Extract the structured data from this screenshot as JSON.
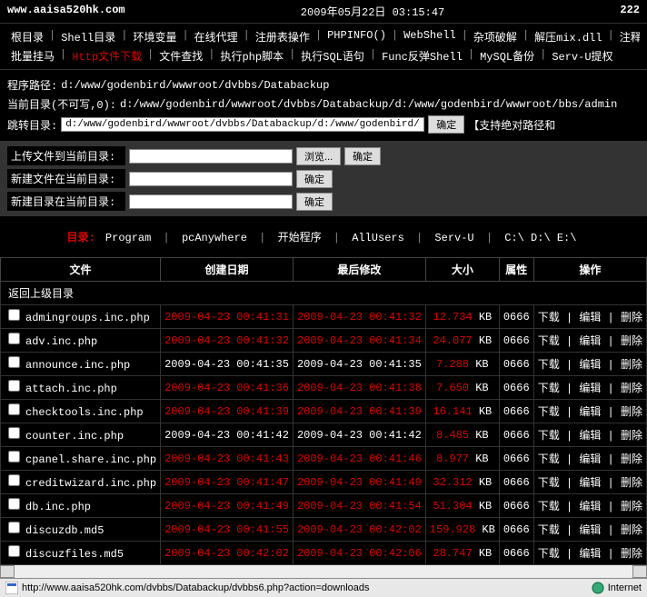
{
  "header": {
    "url": "www.aaisa520hk.com",
    "datetime": "2009年05月22日 03:15:47",
    "count": "222"
  },
  "menu": {
    "row1": [
      "根目录",
      "Shell目录",
      "环境变量",
      "在线代理",
      "注册表操作",
      "PHPINFO()",
      "WebShell",
      "杂项破解",
      "解压mix.dll",
      "注释"
    ],
    "row2": [
      "批量挂马",
      "Http文件下载",
      "文件查找",
      "执行php脚本",
      "执行SQL语句",
      "Func反弹Shell",
      "MySQL备份",
      "Serv-U提权"
    ],
    "active": "Http文件下载"
  },
  "paths": {
    "prog_label": "程序路径:",
    "prog_val": "d:/www/godenbird/wwwroot/dvbbs/Databackup",
    "cur_label": "当前目录(不可写,0):",
    "cur_val": "d:/www/godenbird/wwwroot/dvbbs/Databackup/d:/www/godenbird/wwwroot/bbs/admin",
    "jump_label": "跳转目录:",
    "jump_val": "d:/www/godenbird/wwwroot/dvbbs/Databackup/d:/www/godenbird/wwwroot/bbs/admin",
    "confirm": "确定",
    "support": "【支持绝对路径和"
  },
  "forms": {
    "upload_label": "上传文件到当前目录:",
    "browse": "浏览...",
    "newfile_label": "新建文件在当前目录:",
    "newdir_label": "新建目录在当前目录:",
    "confirm": "确定"
  },
  "quicklinks": {
    "label": "目录:",
    "items": [
      "Program",
      "pcAnywhere",
      "开始程序",
      "AllUsers",
      "Serv-U",
      "C:\\ D:\\ E:\\"
    ]
  },
  "table": {
    "headers": [
      "文件",
      "创建日期",
      "最后修改",
      "大小",
      "属性",
      "操作"
    ],
    "back": "返回上级目录",
    "actions": {
      "dl": "下载",
      "ed": "编辑",
      "del": "删除"
    },
    "rows": [
      {
        "name": "admingroups.inc.php",
        "created": "2009-04-23 00:41:31",
        "modified": "2009-04-23 00:41:32",
        "size": "12.734",
        "attr": "0666",
        "cred": true,
        "mred": true
      },
      {
        "name": "adv.inc.php",
        "created": "2009-04-23 00:41:32",
        "modified": "2009-04-23 00:41:34",
        "size": "24.077",
        "attr": "0666",
        "cred": true,
        "mred": true
      },
      {
        "name": "announce.inc.php",
        "created": "2009-04-23 00:41:35",
        "modified": "2009-04-23 00:41:35",
        "size": "7.288",
        "attr": "0666",
        "cred": false,
        "mred": false
      },
      {
        "name": "attach.inc.php",
        "created": "2009-04-23 00:41:36",
        "modified": "2009-04-23 00:41:38",
        "size": "7.650",
        "attr": "0666",
        "cred": true,
        "mred": true
      },
      {
        "name": "checktools.inc.php",
        "created": "2009-04-23 00:41:39",
        "modified": "2009-04-23 00:41:39",
        "size": "16.141",
        "attr": "0666",
        "cred": true,
        "mred": true
      },
      {
        "name": "counter.inc.php",
        "created": "2009-04-23 00:41:42",
        "modified": "2009-04-23 00:41:42",
        "size": "8.485",
        "attr": "0666",
        "cred": false,
        "mred": false
      },
      {
        "name": "cpanel.share.inc.php",
        "created": "2009-04-23 00:41:43",
        "modified": "2009-04-23 00:41:46",
        "size": "8.977",
        "attr": "0666",
        "cred": true,
        "mred": true
      },
      {
        "name": "creditwizard.inc.php",
        "created": "2009-04-23 00:41:47",
        "modified": "2009-04-23 00:41:49",
        "size": "32.312",
        "attr": "0666",
        "cred": true,
        "mred": true
      },
      {
        "name": "db.inc.php",
        "created": "2009-04-23 00:41:49",
        "modified": "2009-04-23 00:41:54",
        "size": "51.304",
        "attr": "0666",
        "cred": true,
        "mred": true
      },
      {
        "name": "discuzdb.md5",
        "created": "2009-04-23 00:41:55",
        "modified": "2009-04-23 00:42:02",
        "size": "159.928",
        "attr": "0666",
        "cred": true,
        "mred": true
      },
      {
        "name": "discuzfiles.md5",
        "created": "2009-04-23 00:42:02",
        "modified": "2009-04-23 00:42:06",
        "size": "28.747",
        "attr": "0666",
        "cred": true,
        "mred": true
      }
    ]
  },
  "status": {
    "url": "http://www.aaisa520hk.com/dvbbs/Databackup/dvbbs6.php?action=downloads",
    "zone": "Internet"
  }
}
